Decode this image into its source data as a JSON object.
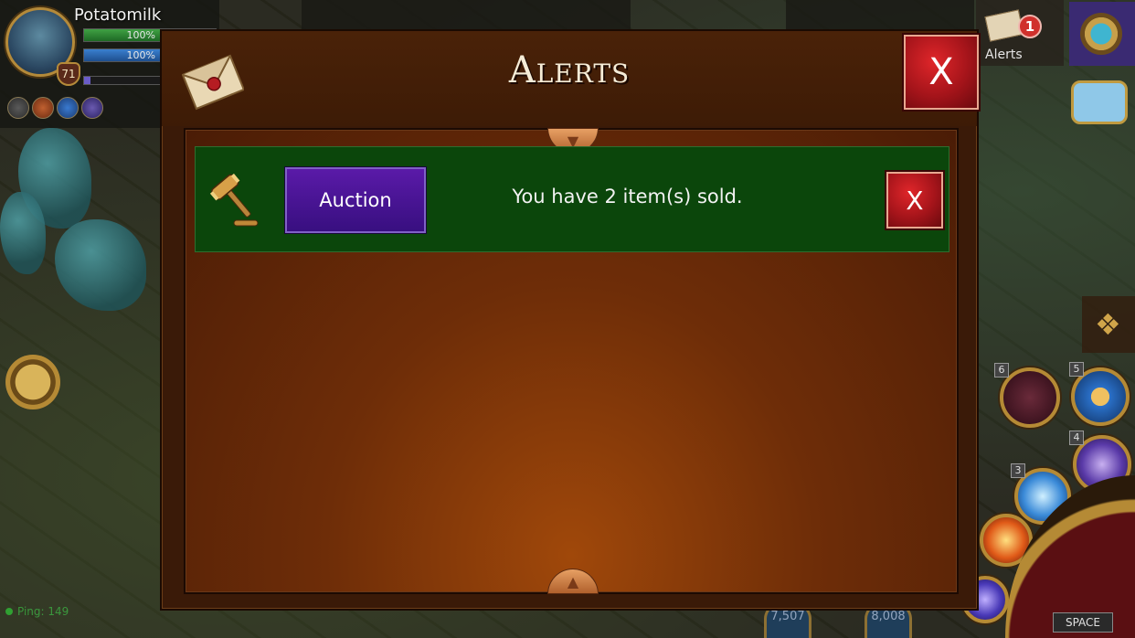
{
  "player": {
    "name": "Potatomilk",
    "level": "71",
    "hp_text": "100%",
    "mp_text": "100%",
    "hp_fraction": 1.0,
    "mp_fraction": 1.0,
    "xp_fraction": 0.05
  },
  "hud": {
    "alerts_label": "Alerts",
    "alerts_count": "1",
    "ping_text": "Ping: 149",
    "space_label": "SPACE",
    "skill_numbers": [
      "6",
      "5",
      "4",
      "3"
    ],
    "orb_values": [
      "7,507",
      "8,008"
    ]
  },
  "dialog": {
    "title": "Alerts",
    "close_label": "X",
    "alerts": [
      {
        "category_button": "Auction",
        "message": "You have 2 item(s) sold.",
        "dismiss_label": "X",
        "icon": "gavel-icon"
      }
    ]
  },
  "colors": {
    "dialog_bg": "#3a1a08",
    "alert_row_bg": "#0b460b",
    "auction_button": "#4a15a0",
    "close_red": "#c01a1e",
    "title_text": "#f5ecd7"
  }
}
